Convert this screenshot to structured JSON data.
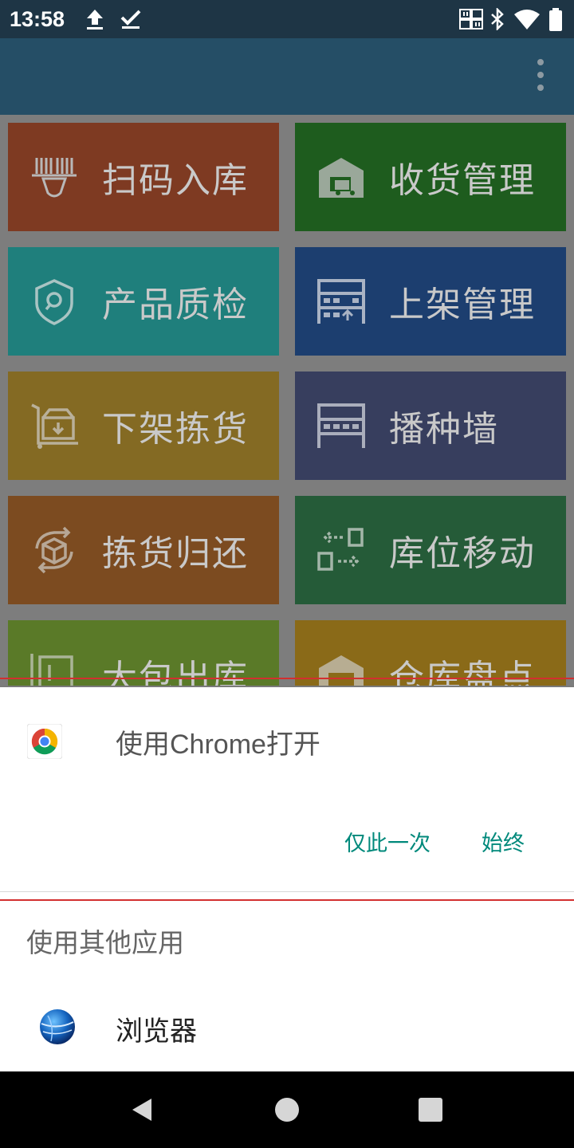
{
  "status_bar": {
    "time": "13:58",
    "icons_left": [
      "upload-icon",
      "check-icon"
    ],
    "icons_right": [
      "barcode-icon",
      "bluetooth-icon",
      "wifi-icon",
      "battery-icon"
    ]
  },
  "toolbar": {
    "menu_icon": "more-vert-icon"
  },
  "tiles": [
    {
      "label": "扫码入库",
      "color": "#7e3a22",
      "icon": "barcode-scanner-icon"
    },
    {
      "label": "收货管理",
      "color": "#1e5c1e",
      "icon": "warehouse-truck-icon"
    },
    {
      "label": "产品质检",
      "color": "#1f7f7c",
      "icon": "shield-search-icon"
    },
    {
      "label": "上架管理",
      "color": "#1c3e6f",
      "icon": "shelf-up-icon"
    },
    {
      "label": "下架拣货",
      "color": "#846a23",
      "icon": "cart-box-icon"
    },
    {
      "label": "播种墙",
      "color": "#373e5e",
      "icon": "wall-grid-icon"
    },
    {
      "label": "拣货归还",
      "color": "#7c4b20",
      "icon": "box-return-icon"
    },
    {
      "label": "库位移动",
      "color": "#255b38",
      "icon": "move-arrows-icon"
    },
    {
      "label": "大包出库",
      "color": "#5a7a28",
      "icon": "package-out-icon"
    },
    {
      "label": "仓库盘点",
      "color": "#8a6a18",
      "icon": "warehouse-count-icon"
    }
  ],
  "sheet": {
    "chrome_title": "使用Chrome打开",
    "once_label": "仅此一次",
    "always_label": "始终",
    "other_apps_title": "使用其他应用",
    "browser_label": "浏览器"
  },
  "nav_bar": {
    "back_icon": "back-triangle-icon",
    "home_icon": "home-circle-icon",
    "recents_icon": "recents-square-icon"
  }
}
